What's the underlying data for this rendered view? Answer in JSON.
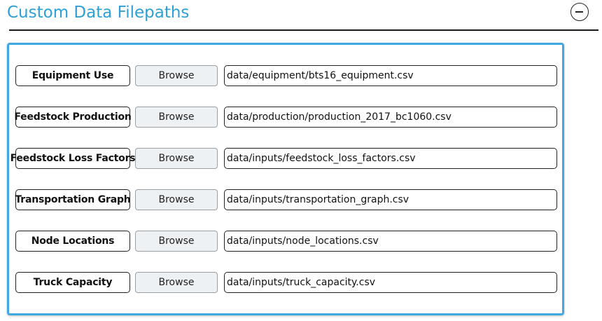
{
  "section": {
    "title": "Custom Data Filepaths"
  },
  "rows": [
    {
      "label": "Equipment Use",
      "button": "Browse",
      "path": "data/equipment/bts16_equipment.csv"
    },
    {
      "label": "Feedstock Production",
      "button": "Browse",
      "path": "data/production/production_2017_bc1060.csv"
    },
    {
      "label": "Feedstock Loss Factors",
      "button": "Browse",
      "path": "data/inputs/feedstock_loss_factors.csv"
    },
    {
      "label": "Transportation Graph",
      "button": "Browse",
      "path": "data/inputs/transportation_graph.csv"
    },
    {
      "label": "Node Locations",
      "button": "Browse",
      "path": "data/inputs/node_locations.csv"
    },
    {
      "label": "Truck Capacity",
      "button": "Browse",
      "path": "data/inputs/truck_capacity.csv"
    }
  ],
  "icons": {
    "collapse": "minus-circle-icon"
  },
  "colors": {
    "accent": "#2fa0d6",
    "panel_border": "#3ea8e0"
  }
}
